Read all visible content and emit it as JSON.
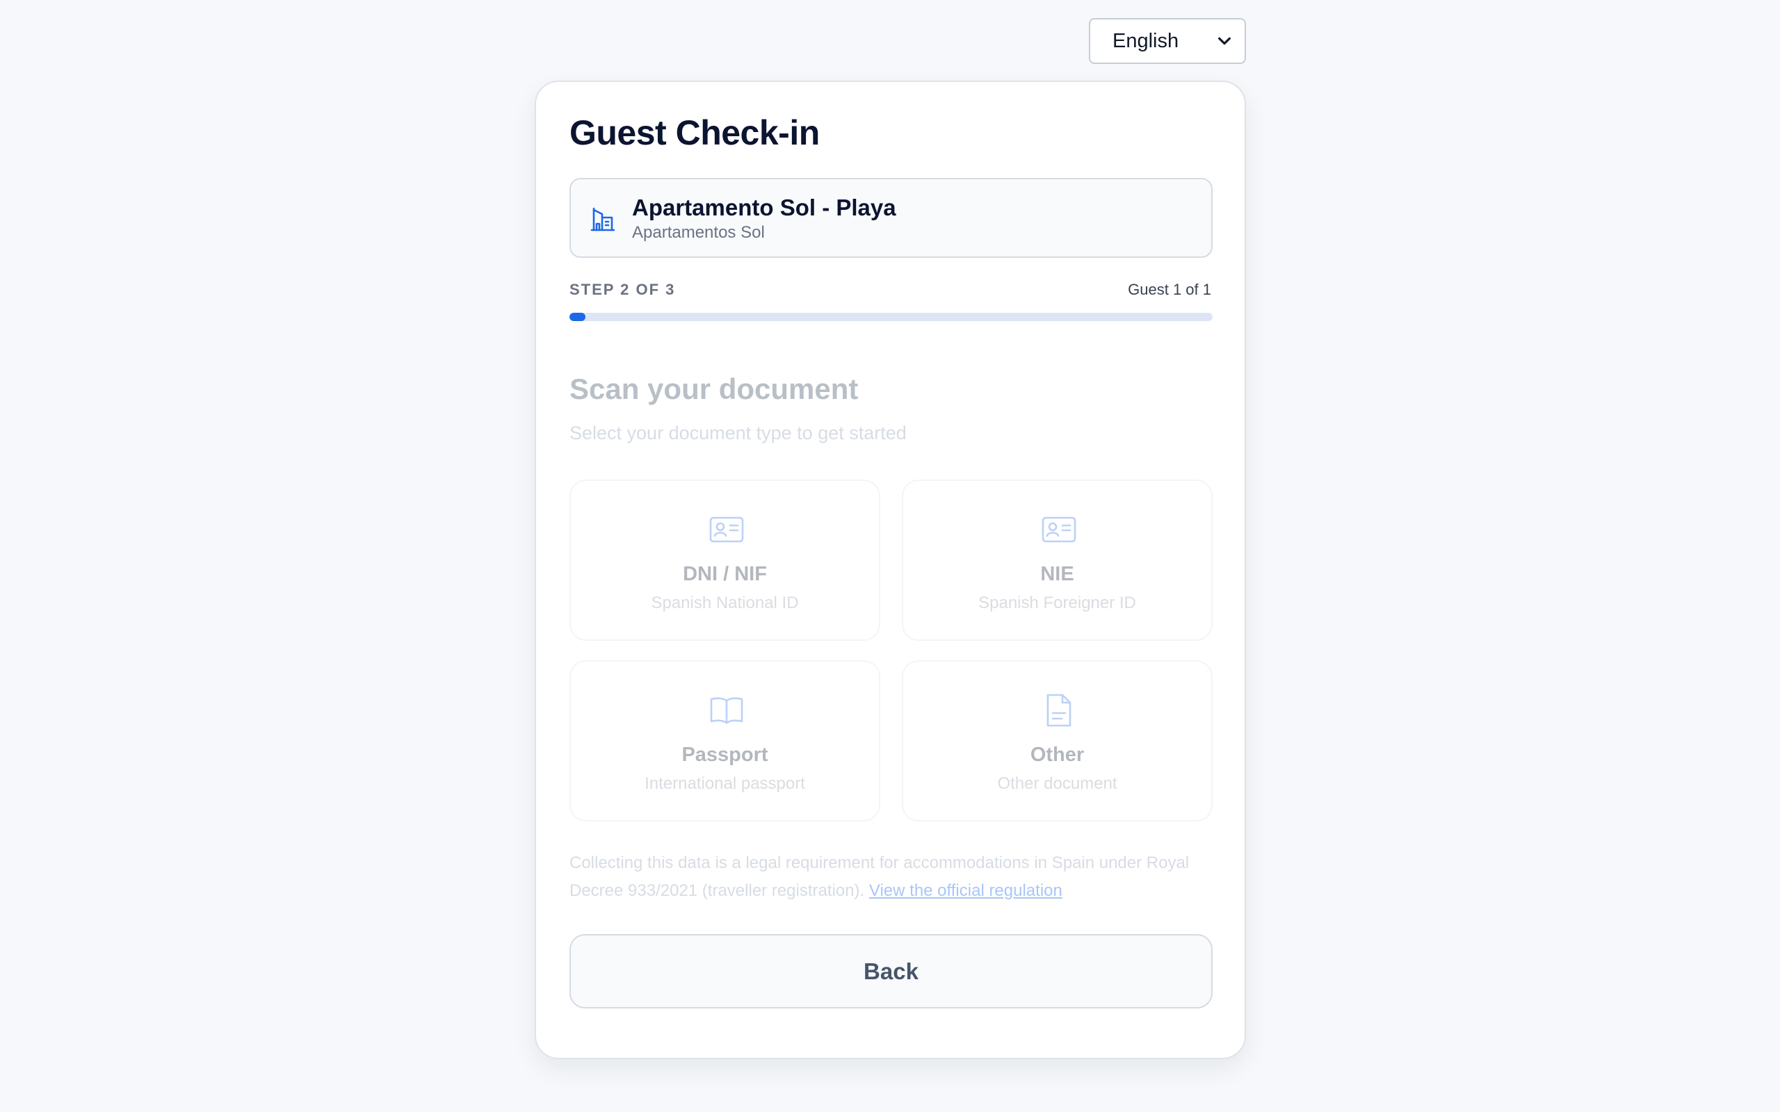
{
  "language_select": {
    "selected": "English"
  },
  "checkin": {
    "title": "Guest Check-in"
  },
  "property": {
    "name": "Apartamento Sol - Playa",
    "group": "Apartamentos Sol",
    "icon": "building-icon"
  },
  "progress": {
    "step_label": "STEP 2 OF 3",
    "guest_label": "Guest 1 of 1",
    "fill_fraction": 0.025,
    "accent_color": "#1d68e6"
  },
  "scan": {
    "title": "Scan your document",
    "subtitle": "Select your document type to get started"
  },
  "documents": [
    {
      "name": "DNI / NIF",
      "description": "Spanish National ID",
      "icon": "id-card-icon"
    },
    {
      "name": "NIE",
      "description": "Spanish Foreigner ID",
      "icon": "id-card-icon"
    },
    {
      "name": "Passport",
      "description": "International passport",
      "icon": "open-book-icon"
    },
    {
      "name": "Other",
      "description": "Other document",
      "icon": "file-icon"
    }
  ],
  "legal": {
    "text": "Collecting this data is a legal requirement for accommodations in Spain under Royal Decree 933/2021 (traveller registration).",
    "link_label": "View the official regulation"
  },
  "actions": {
    "back_label": "Back"
  }
}
